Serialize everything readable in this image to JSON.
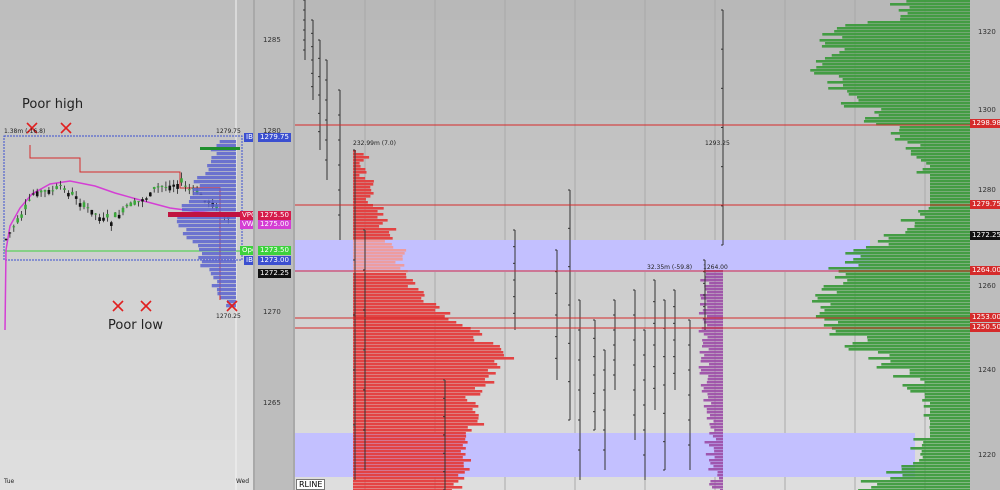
{
  "annotations": {
    "poor_high": "Poor high",
    "poor_low": "Poor low"
  },
  "left_chart": {
    "top_info": "1.38m (-16.8)",
    "high_value": "1279.75",
    "low_value": "1270.25",
    "day_start": "Tue",
    "day_end": "Wed",
    "axis_ticks": [
      "1285",
      "1280",
      "1270",
      "1265"
    ],
    "tags": {
      "ibh": "IBH",
      "ibh_price": "1279.75",
      "vpoc": "VPOC",
      "vpoc_price": "1275.50",
      "vwap": "VWAP",
      "vwap_price": "1275.00",
      "open": "Open",
      "open_price": "1273.50",
      "ibl": "IBL",
      "ibl_price": "1273.00",
      "last": "1272.25"
    }
  },
  "right_chart": {
    "rline": "RLINE",
    "profile1_label": "232.99m (7.0)",
    "profile2_label": "32.35m (-59.8)",
    "profile2_price": "1264.00",
    "spike_price": "1293.25",
    "axis_ticks": [
      "1320",
      "1300",
      "1280",
      "1260",
      "1240",
      "1220"
    ],
    "tags": {
      "l1": "1298.98",
      "l2": "1279.75",
      "last": "1272.25",
      "l3": "1264.00",
      "l4": "1253.00",
      "l5": "1250.50"
    }
  },
  "colors": {
    "red_profile": "#e43b3b",
    "green_profile": "#3c9a3c",
    "value_area": "#c3c0ff",
    "purple_profile": "#9b4aa6",
    "vwap": "#d43fd4",
    "level_line": "#d52b2b"
  },
  "chart_data": {
    "type": "candlestick-volume-profile",
    "title": "",
    "left_panel": {
      "y_axis_ticks": [
        1285,
        1280,
        1270,
        1265
      ],
      "levels": {
        "IBH": 1279.75,
        "VPOC": 1275.5,
        "VWAP": 1275.0,
        "Open": 1273.5,
        "IBL": 1273.0,
        "Last": 1272.25,
        "Session_Low": 1270.25
      }
    },
    "right_panel": {
      "y_axis_ticks": [
        1320,
        1300,
        1280,
        1260,
        1240,
        1220
      ],
      "levels": [
        1298.98,
        1279.75,
        1264.0,
        1253.0,
        1250.5
      ],
      "last": 1272.25
    }
  }
}
